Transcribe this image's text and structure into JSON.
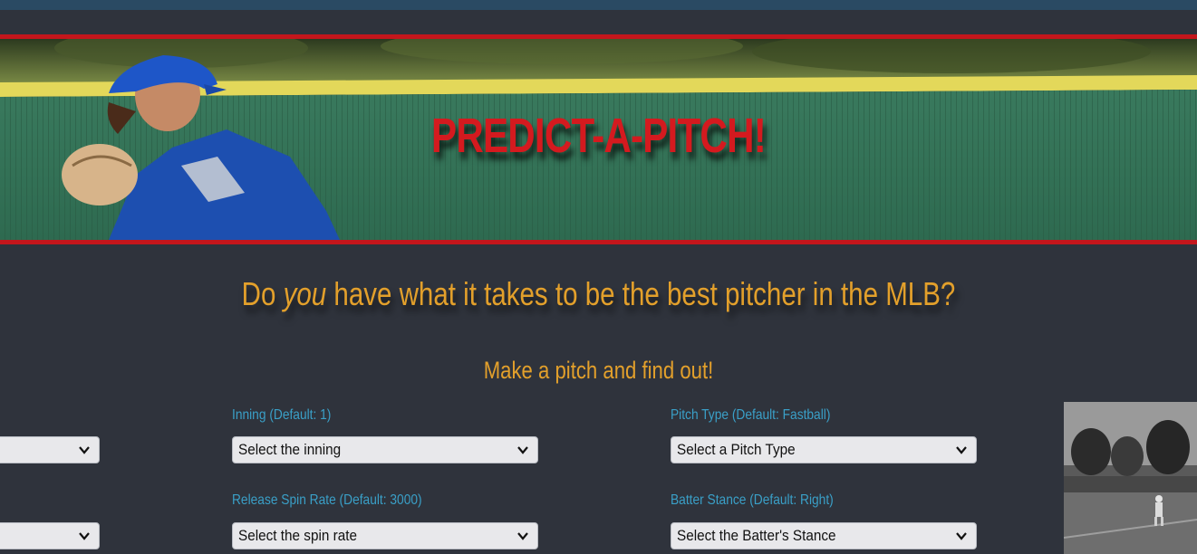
{
  "banner": {
    "title": "PREDICT-A-PITCH!"
  },
  "hero": {
    "headline_before": "Do ",
    "headline_em": "you",
    "headline_after": " have what it takes to be the best pitcher in the MLB?",
    "subheadline": "Make a pitch and find out!"
  },
  "form": {
    "inning": {
      "label": "Inning (Default: 1)",
      "value": "Select the inning"
    },
    "pitch_type": {
      "label": "Pitch Type (Default: Fastball)",
      "value": "Select a Pitch Type"
    },
    "spin_rate": {
      "label": "Release Spin Rate (Default: 3000)",
      "value": "Select the spin rate"
    },
    "batter_stance": {
      "label": "Batter Stance (Default: Right)",
      "value": "Select the Batter's Stance"
    }
  },
  "colors": {
    "background": "#2f333c",
    "accent_red": "#d41a1f",
    "headline_gold": "#e3a02b",
    "label_blue": "#3aa0c8"
  },
  "icons": {
    "dropdown": "chevron-down-icon"
  }
}
